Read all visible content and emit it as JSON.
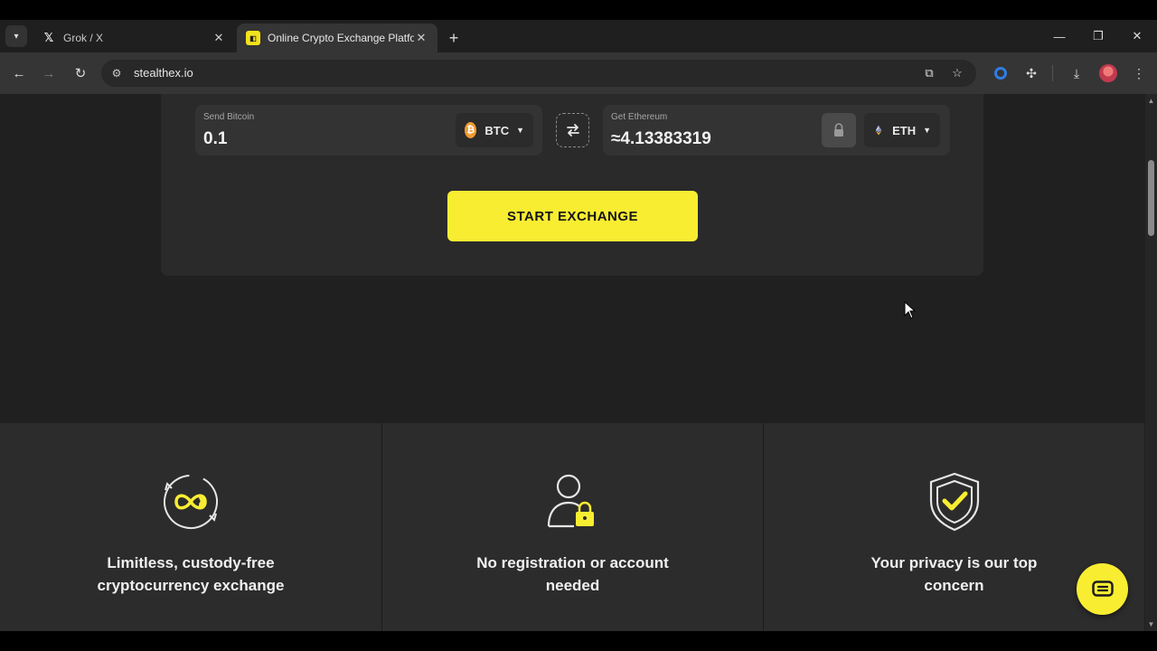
{
  "browser": {
    "tabs": [
      {
        "title": "Grok / X",
        "active": false
      },
      {
        "title": "Online Crypto Exchange Platfor",
        "active": true
      }
    ],
    "url": "stealthex.io"
  },
  "exchange": {
    "send": {
      "label": "Send Bitcoin",
      "amount": "0.1",
      "currency": "BTC"
    },
    "get": {
      "label": "Get Ethereum",
      "amount": "≈4.13383319",
      "currency": "ETH"
    },
    "start_label": "START EXCHANGE"
  },
  "features": [
    {
      "icon": "infinity-icon",
      "text": "Limitless, custody-free cryptocurrency exchange"
    },
    {
      "icon": "user-lock-icon",
      "text": "No registration or account needed"
    },
    {
      "icon": "shield-check-icon",
      "text": "Your privacy is our top concern"
    }
  ],
  "colors": {
    "accent": "#f9ed32",
    "btc": "#f29a2e",
    "background": "#202020"
  }
}
